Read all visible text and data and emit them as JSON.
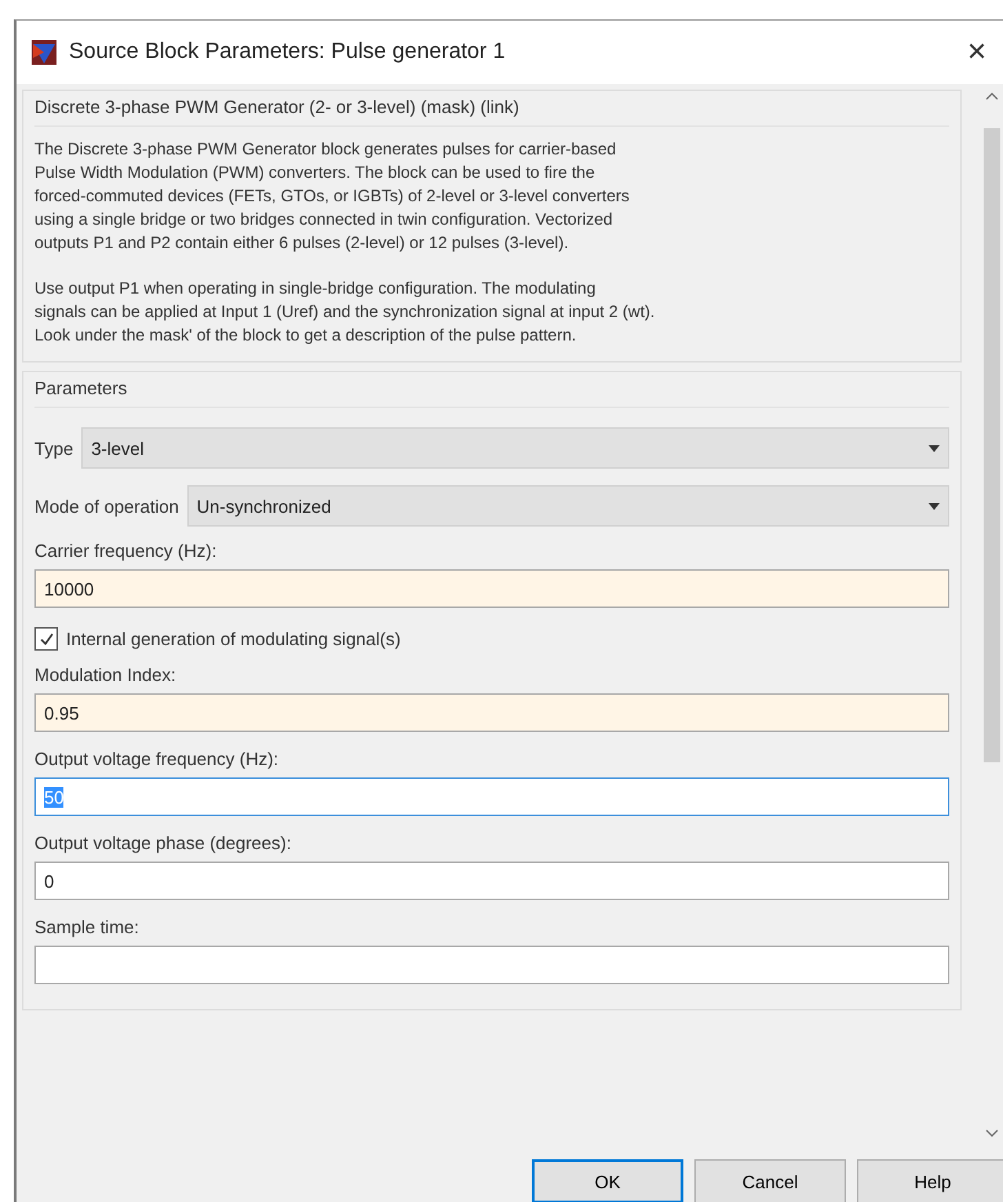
{
  "window": {
    "title": "Source Block Parameters: Pulse generator 1",
    "close": "×"
  },
  "mask": {
    "title": "Discrete 3-phase PWM Generator (2- or 3-level) (mask) (link)",
    "paragraphs": [
      [
        "The Discrete 3-phase PWM Generator block generates pulses for carrier-based",
        "Pulse Width Modulation (PWM) converters. The block can be used to fire the",
        "forced-commuted devices (FETs, GTOs, or IGBTs) of 2-level or 3-level converters",
        "using a single  bridge or two bridges connected in twin configuration. Vectorized",
        "outputs P1 and P2 contain  either 6 pulses (2-level) or 12 pulses (3-level)."
      ],
      [
        "Use output P1 when operating in single-bridge configuration. The modulating",
        "signals can be applied at Input 1 (Uref) and the synchronization signal at input 2 (wt).",
        "Look under the mask' of the block to get a description of the pulse pattern."
      ]
    ]
  },
  "parameters": {
    "title": "Parameters",
    "items": [
      {
        "kind": "dropdown",
        "label": "Type",
        "value": "3-level"
      },
      {
        "kind": "dropdown",
        "label": "Mode of operation",
        "value": "Un-synchronized"
      },
      {
        "kind": "edit",
        "label": "Carrier frequency (Hz):",
        "value": "10000",
        "modified": true,
        "focused": false
      },
      {
        "kind": "checkbox",
        "label": "Internal generation of modulating signal(s)",
        "checked": true
      },
      {
        "kind": "edit",
        "label": "Modulation Index:",
        "value": "0.95",
        "modified": true,
        "focused": false
      },
      {
        "kind": "edit",
        "label": "Output voltage frequency (Hz):",
        "value": "50",
        "modified": false,
        "focused": true
      },
      {
        "kind": "edit",
        "label": "Output voltage phase (degrees):",
        "value": "0",
        "modified": false,
        "focused": false
      },
      {
        "kind": "edit",
        "label": "Sample time:",
        "modified": false,
        "focused": false
      }
    ]
  },
  "buttons": [
    {
      "label": "OK",
      "default": true
    },
    {
      "label": "Cancel",
      "default": false
    },
    {
      "label": "Help",
      "default": false
    }
  ]
}
